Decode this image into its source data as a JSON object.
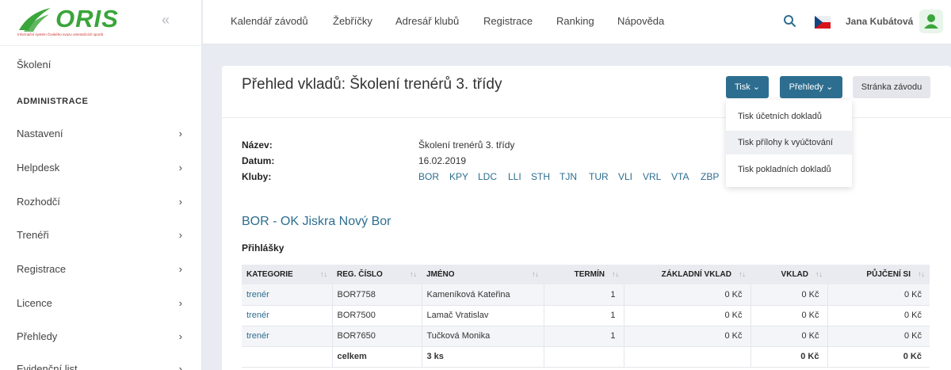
{
  "logo": {
    "text": "ORIS",
    "subtitle": "Informační systém Českého svazu orientačních sportů"
  },
  "sidebar": {
    "top_item": "Školení",
    "admin_heading": "ADMINISTRACE",
    "items": [
      {
        "label": "Nastavení"
      },
      {
        "label": "Helpdesk"
      },
      {
        "label": "Rozhodčí"
      },
      {
        "label": "Trenéři"
      },
      {
        "label": "Registrace"
      },
      {
        "label": "Licence"
      },
      {
        "label": "Přehledy"
      },
      {
        "label": "Evidenční list"
      }
    ]
  },
  "nav": [
    "Kalendář závodů",
    "Žebříčky",
    "Adresář klubů",
    "Registrace",
    "Ranking",
    "Nápověda"
  ],
  "user": {
    "name": "Jana Kubátová"
  },
  "page": {
    "title": "Přehled vkladů: Školení trenérů 3. třídy",
    "buttons": {
      "print": "Tisk",
      "reports": "Přehledy",
      "event_page": "Stránka závodu"
    },
    "print_menu": [
      "Tisk účetních dokladů",
      "Tisk přílohy k vyúčtování",
      "Tisk pokladních dokladů"
    ]
  },
  "info": {
    "name_label": "Název:",
    "name_value": "Školení trenérů 3. třídy",
    "date_label": "Datum:",
    "date_value": "16.02.2019",
    "clubs_label": "Kluby:",
    "clubs": [
      "BOR",
      "KPY",
      "LDC",
      "LLI",
      "STH",
      "TJN",
      "TUR",
      "VLI",
      "VRL",
      "VTA",
      "ZBP"
    ]
  },
  "section": {
    "title": "BOR - OK Jiskra Nový Bor",
    "subtitle": "Přihlášky"
  },
  "table": {
    "headers": [
      "KATEGORIE",
      "REG. ČÍSLO",
      "JMÉNO",
      "TERMÍN",
      "ZÁKLADNÍ VKLAD",
      "VKLAD",
      "PŮJČENÍ SI"
    ],
    "rows": [
      [
        "trenér",
        "BOR7758",
        "Kameníková Kateřina",
        "1",
        "0 Kč",
        "0 Kč",
        "0 Kč"
      ],
      [
        "trenér",
        "BOR7500",
        "Lamač Vratislav",
        "1",
        "0 Kč",
        "0 Kč",
        "0 Kč"
      ],
      [
        "trenér",
        "BOR7650",
        "Tučková Monika",
        "1",
        "0 Kč",
        "0 Kč",
        "0 Kč"
      ]
    ],
    "total": [
      "",
      "celkem",
      "3 ks",
      "",
      "",
      "0 Kč",
      "0 Kč"
    ]
  },
  "colors": {
    "accent": "#2d6e90",
    "logo_green": "#3aa53a"
  }
}
